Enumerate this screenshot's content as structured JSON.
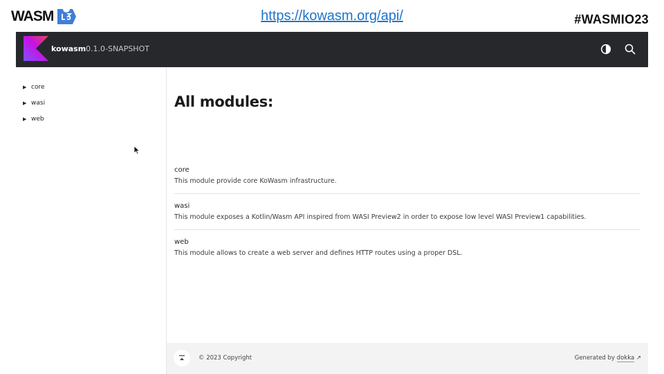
{
  "slide": {
    "logo_text": "WASM",
    "url": "https://kowasm.org/api/",
    "hashtag": "#WASMIO23"
  },
  "header": {
    "project_name": "kowasm",
    "version": "0.1.0-SNAPSHOT",
    "theme_icon": "contrast-icon",
    "search_icon": "search-icon"
  },
  "sidebar": {
    "items": [
      {
        "label": "core"
      },
      {
        "label": "wasi"
      },
      {
        "label": "web"
      }
    ]
  },
  "main": {
    "title": "All modules:",
    "modules": [
      {
        "name": "core",
        "description": "This module provide core KoWasm infrastructure."
      },
      {
        "name": "wasi",
        "description": "This module exposes a Kotlin/Wasm API inspired from WASI Preview2 in order to expose low level WASI Preview1 capabilities."
      },
      {
        "name": "web",
        "description": "This module allows to create a web server and defines HTTP routes using a proper DSL."
      }
    ]
  },
  "footer": {
    "copyright": "© 2023 Copyright",
    "generated_prefix": "Generated by ",
    "generated_link": "dokka",
    "arrow": "↗"
  },
  "colors": {
    "topbar": "#27282c",
    "url": "#1e74c9",
    "kotlin_gradient": [
      "#7f52ff",
      "#c711e1",
      "#e44857"
    ]
  }
}
